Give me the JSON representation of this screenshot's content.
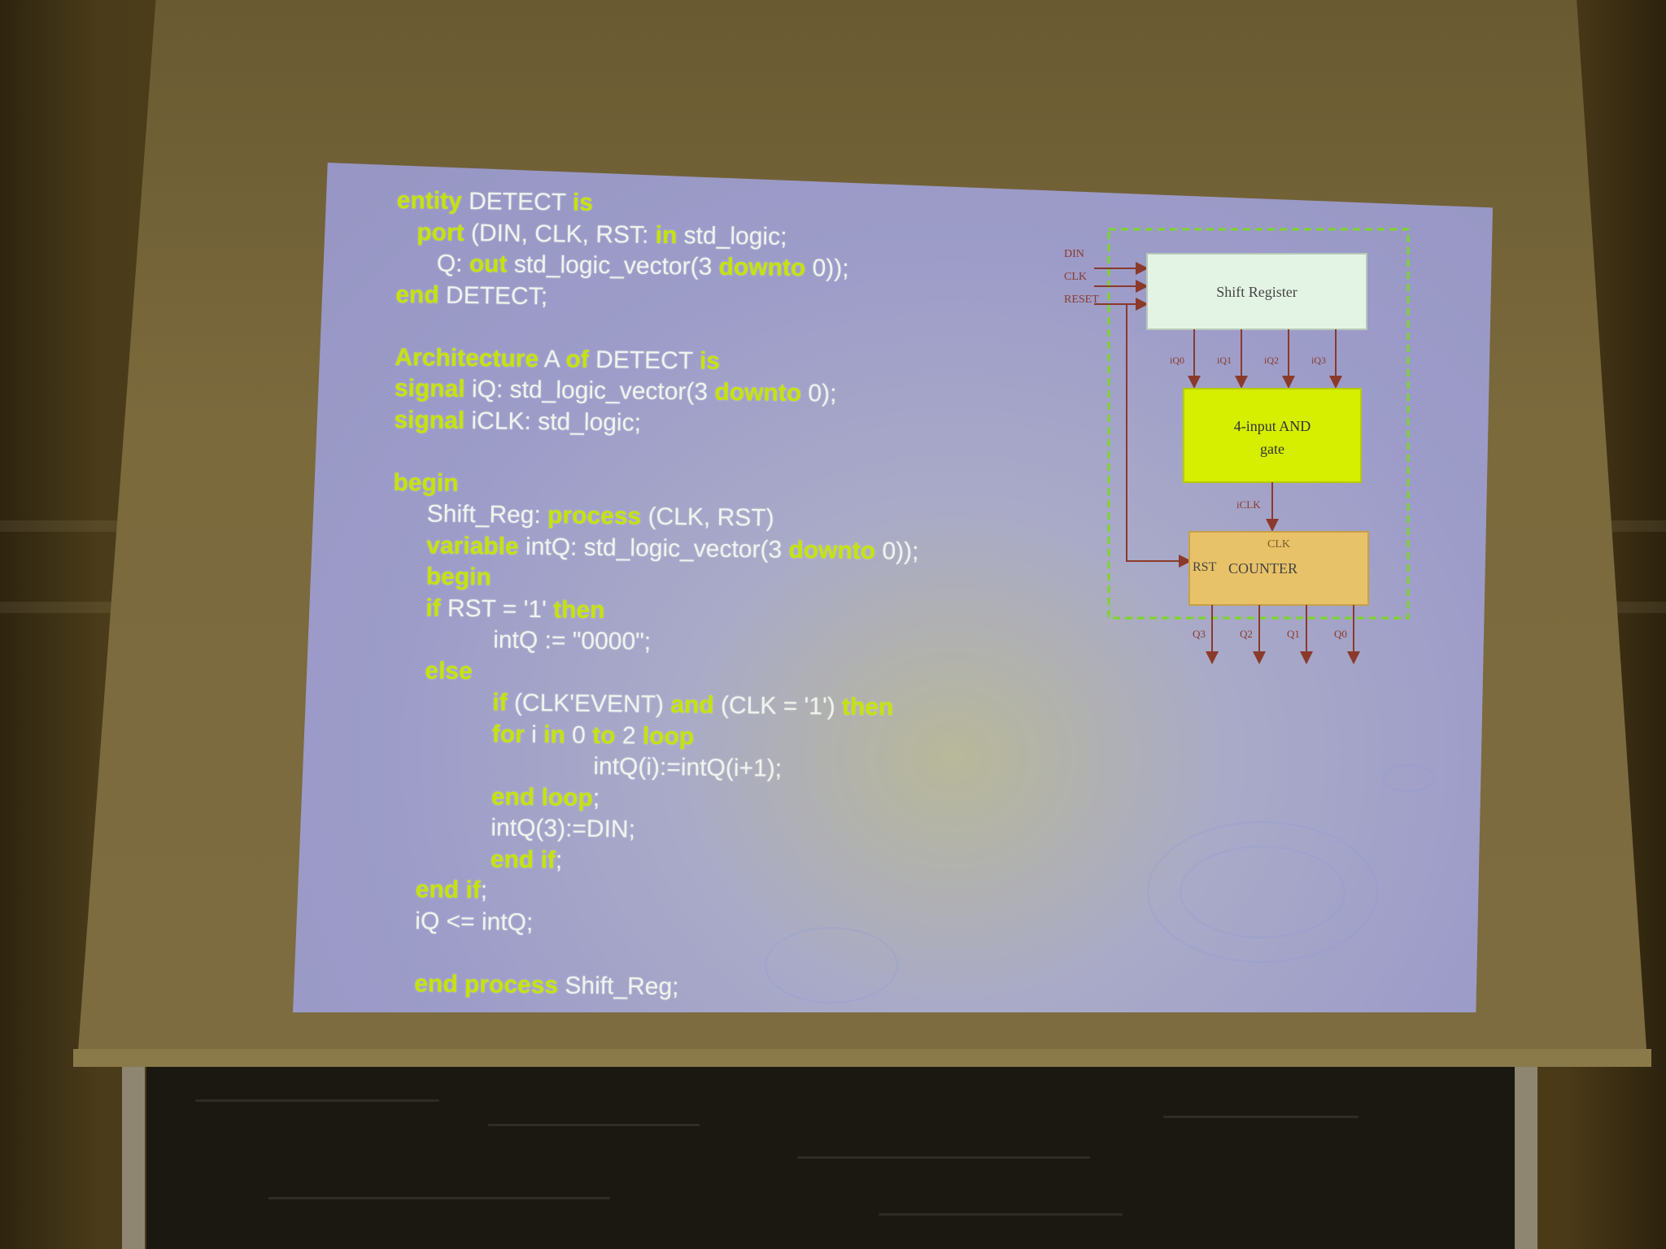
{
  "slide": {
    "code_lines": [
      [
        {
          "t": "entity",
          "k": true
        },
        {
          "t": " DETECT ",
          "k": false
        },
        {
          "t": "is",
          "k": true
        }
      ],
      [
        {
          "t": "   ",
          "k": false
        },
        {
          "t": "port",
          "k": true
        },
        {
          "t": " (DIN, CLK, RST: ",
          "k": false
        },
        {
          "t": "in",
          "k": true
        },
        {
          "t": " std_logic;",
          "k": false
        }
      ],
      [
        {
          "t": "      Q: ",
          "k": false
        },
        {
          "t": "out",
          "k": true
        },
        {
          "t": " std_logic_vector(3 ",
          "k": false
        },
        {
          "t": "downto",
          "k": true
        },
        {
          "t": " 0));",
          "k": false
        }
      ],
      [
        {
          "t": "end",
          "k": true
        },
        {
          "t": " DETECT;",
          "k": false
        }
      ],
      [],
      [
        {
          "t": "Architecture",
          "k": true
        },
        {
          "t": " A ",
          "k": false
        },
        {
          "t": "of",
          "k": true
        },
        {
          "t": " DETECT ",
          "k": false
        },
        {
          "t": "is",
          "k": true
        }
      ],
      [
        {
          "t": "signal",
          "k": true
        },
        {
          "t": " iQ: std_logic_vector(3 ",
          "k": false
        },
        {
          "t": "downto",
          "k": true
        },
        {
          "t": " 0);",
          "k": false
        }
      ],
      [
        {
          "t": "signal",
          "k": true
        },
        {
          "t": " iCLK: std_logic;",
          "k": false
        }
      ],
      [],
      [
        {
          "t": "begin",
          "k": true
        }
      ],
      [
        {
          "t": "     Shift_Reg: ",
          "k": false
        },
        {
          "t": "process",
          "k": true
        },
        {
          "t": " (CLK, RST)",
          "k": false
        }
      ],
      [
        {
          "t": "     ",
          "k": false
        },
        {
          "t": "variable",
          "k": true
        },
        {
          "t": " intQ: std_logic_vector(3 ",
          "k": false
        },
        {
          "t": "downto",
          "k": true
        },
        {
          "t": " 0));",
          "k": false
        }
      ],
      [
        {
          "t": "     ",
          "k": false
        },
        {
          "t": "begin",
          "k": true
        }
      ],
      [
        {
          "t": "     ",
          "k": false
        },
        {
          "t": "if",
          "k": true
        },
        {
          "t": " RST = '1' ",
          "k": false
        },
        {
          "t": "then",
          "k": true
        }
      ],
      [
        {
          "t": "               intQ := \"0000\";",
          "k": false
        }
      ],
      [
        {
          "t": "     ",
          "k": false
        },
        {
          "t": "else",
          "k": true
        }
      ],
      [
        {
          "t": "               ",
          "k": false
        },
        {
          "t": "if",
          "k": true
        },
        {
          "t": " (CLK'EVENT) ",
          "k": false
        },
        {
          "t": "and",
          "k": true
        },
        {
          "t": " (CLK = '1') ",
          "k": false
        },
        {
          "t": "then",
          "k": true
        }
      ],
      [
        {
          "t": "               ",
          "k": false
        },
        {
          "t": "for",
          "k": true
        },
        {
          "t": " i ",
          "k": false
        },
        {
          "t": "in",
          "k": true
        },
        {
          "t": " 0 ",
          "k": false
        },
        {
          "t": "to",
          "k": true
        },
        {
          "t": " 2 ",
          "k": false
        },
        {
          "t": "loop",
          "k": true
        }
      ],
      [
        {
          "t": "                              intQ(i):=intQ(i+1);",
          "k": false
        }
      ],
      [
        {
          "t": "               ",
          "k": false
        },
        {
          "t": "end loop",
          "k": true
        },
        {
          "t": ";",
          "k": false
        }
      ],
      [
        {
          "t": "               intQ(3):=DIN;",
          "k": false
        }
      ],
      [
        {
          "t": "               ",
          "k": false
        },
        {
          "t": "end if",
          "k": true
        },
        {
          "t": ";",
          "k": false
        }
      ],
      [
        {
          "t": "    ",
          "k": false
        },
        {
          "t": "end if",
          "k": true
        },
        {
          "t": ";",
          "k": false
        }
      ],
      [
        {
          "t": "    iQ <= intQ;",
          "k": false
        }
      ],
      [],
      [
        {
          "t": "    ",
          "k": false
        },
        {
          "t": "end process",
          "k": true
        },
        {
          "t": " Shift_Reg;",
          "k": false
        }
      ]
    ]
  },
  "diagram": {
    "inputs": [
      "DIN",
      "CLK",
      "RESET"
    ],
    "shift_register_label": "Shift Register",
    "bus_labels": [
      "iQ0",
      "iQ1",
      "iQ2",
      "iQ3"
    ],
    "and_gate_label_line1": "4-input AND",
    "and_gate_label_line2": "gate",
    "iclk_label": "iCLK",
    "counter_clk_label": "CLK",
    "counter_rst_label": "RST",
    "counter_label": "COUNTER",
    "outputs": [
      "Q3",
      "Q2",
      "Q1",
      "Q0"
    ],
    "colors": {
      "shift_register_fill": "#e4f4e4",
      "and_gate_fill": "#d6ee00",
      "counter_fill": "#e8c268",
      "boundary": "#7cd628",
      "wire": "#8a3a2a"
    }
  }
}
